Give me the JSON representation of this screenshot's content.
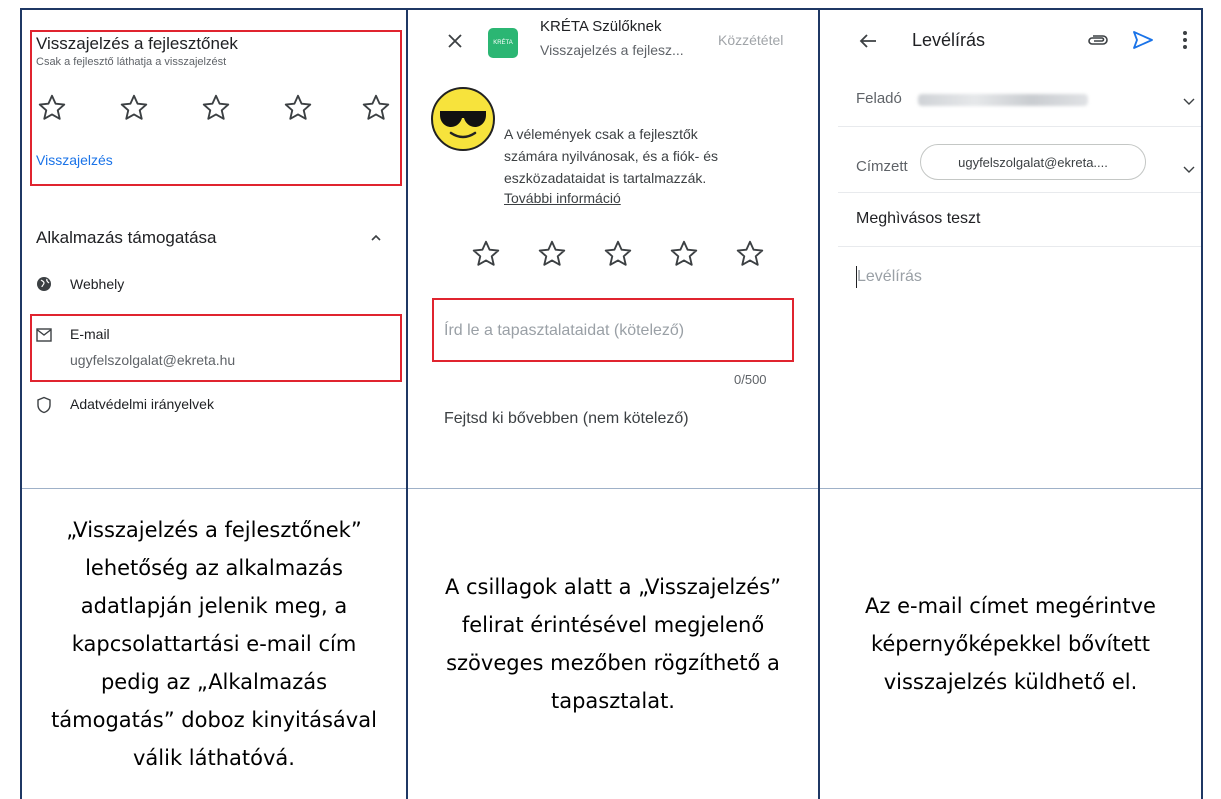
{
  "panel1": {
    "title": "Visszajelzés a fejlesztőnek",
    "subtitle": "Csak a fejlesztő láthatja a visszajelzést",
    "feedback_link": "Visszajelzés",
    "support_heading": "Alkalmazás támogatása",
    "website_label": "Webhely",
    "email_label": "E-mail",
    "email_value": "ugyfelszolgalat@ekreta.hu",
    "privacy_label": "Adatvédelmi irányelvek"
  },
  "panel2": {
    "app_logo_text": "KRÉTA",
    "app_name": "KRÉTA Szülőknek",
    "app_subtitle": "Visszajelzés a fejlesz...",
    "publish_label": "Közzététel",
    "notice_line1": "A vélemények csak a fejlesztők",
    "notice_line2": "számára nyilvánosak, és a fiók- és",
    "notice_line3": "eszközadataidat is tartalmazzák.",
    "more_info_link": "További információ",
    "experience_placeholder": "Írd le a tapasztalataidat (kötelező)",
    "char_counter": "0/500",
    "detail_label": "Fejtsd ki bővebben (nem kötelező)"
  },
  "panel3": {
    "title": "Levélírás",
    "from_label": "Feladó",
    "to_label": "Címzett",
    "to_chip": "ugyfelszolgalat@ekreta....",
    "subject": "Meghìvásos teszt",
    "body_placeholder": "Levélírás"
  },
  "captions": {
    "col1": [
      "„Visszajelzés a fejlesztőnek”",
      "lehetőség az alkalmazás",
      "adatlapján jelenik meg, a",
      "kapcsolattartási e-mail cím",
      "pedig az „Alkalmazás",
      "támogatás” doboz kinyitásával",
      "válik láthatóvá."
    ],
    "col2": [
      "A csillagok alatt a „Visszajelzés”",
      "felirat érintésével megjelenő",
      "szöveges mezőben rögzíthető a",
      "tapasztalat."
    ],
    "col3": [
      "Az e-mail címet megérintve",
      "képernyőképekkel bővített",
      "visszajelzés küldhető el."
    ]
  },
  "colors": {
    "border": "#1f3864",
    "highlight": "#e0242f",
    "link": "#1a73e8",
    "send": "#1a73e8",
    "kreta_green": "#2bb673"
  },
  "icons": [
    "close-icon",
    "star-icon",
    "globe-icon",
    "mail-icon",
    "shield-icon",
    "chevron-up-icon",
    "back-arrow-icon",
    "paperclip-icon",
    "send-icon",
    "more-vert-icon",
    "chevron-down-icon",
    "sunglasses-emoji"
  ]
}
